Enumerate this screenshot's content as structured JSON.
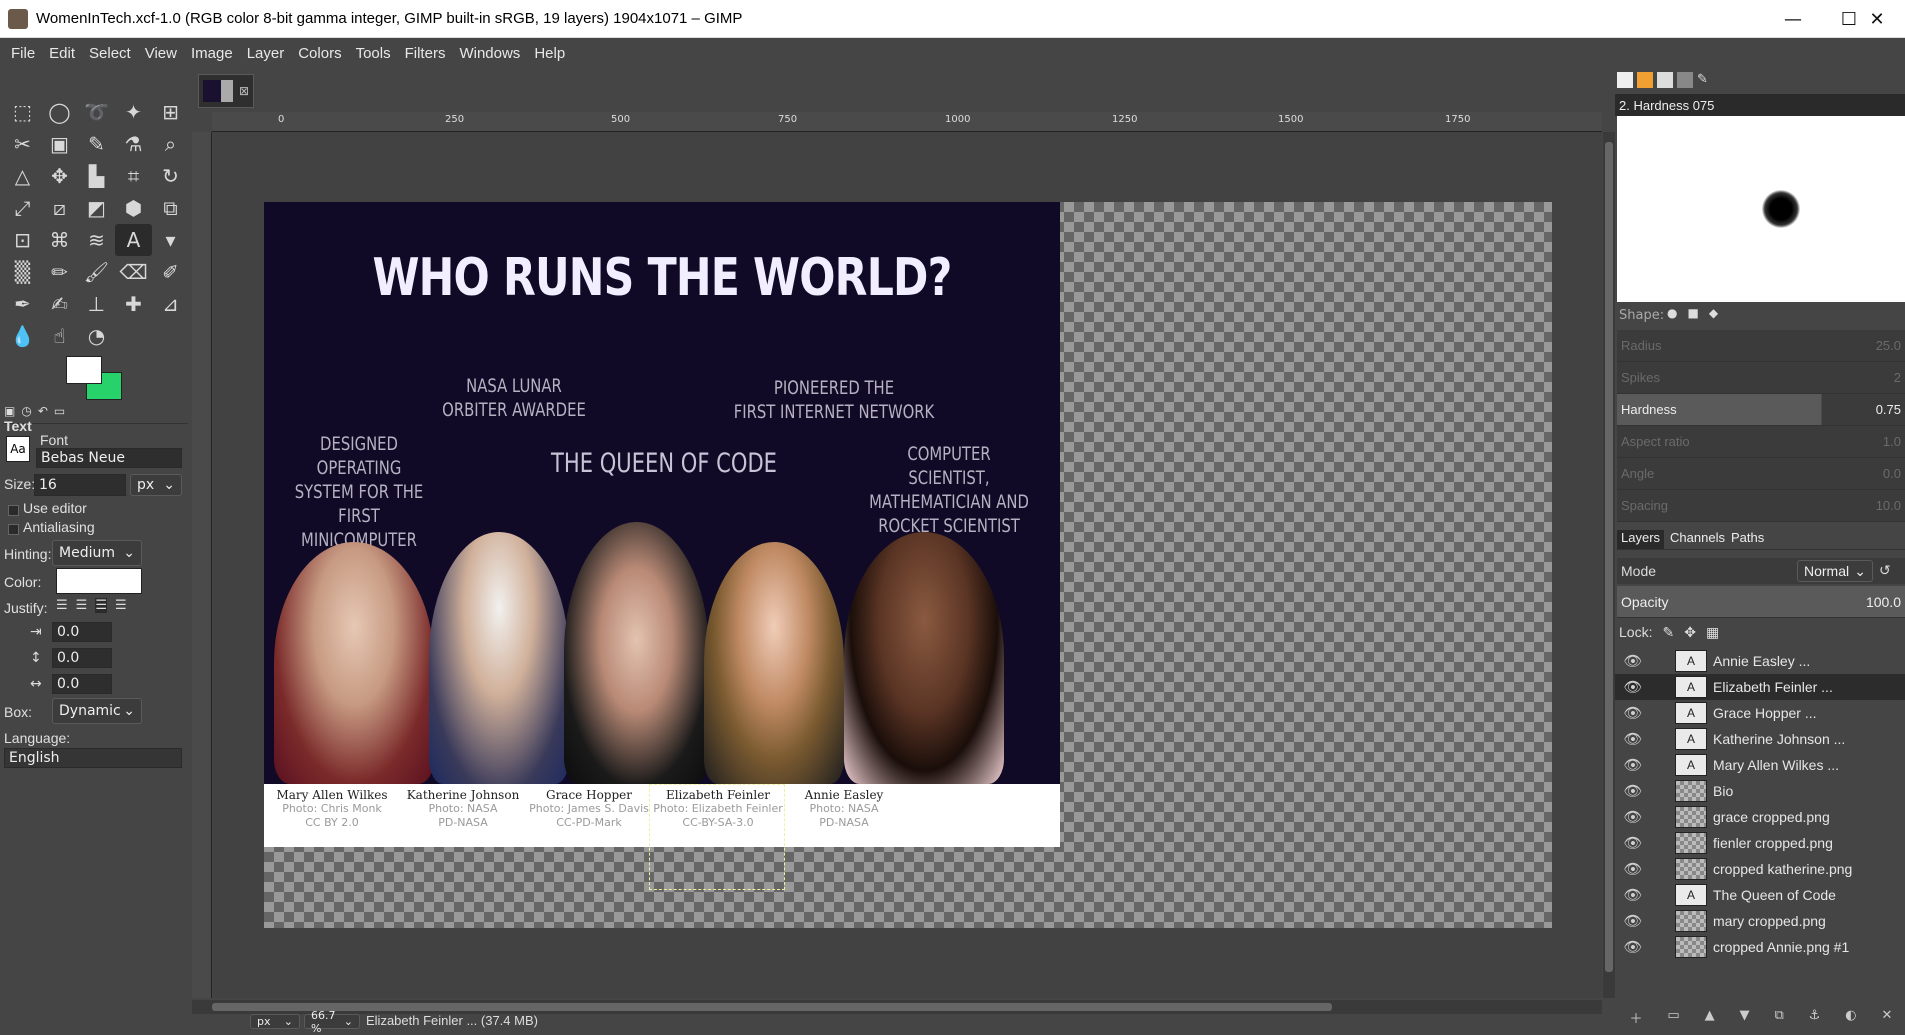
{
  "window": {
    "title": "WomenInTech.xcf-1.0 (RGB color 8-bit gamma integer, GIMP built-in sRGB, 19 layers) 1904x1071 – GIMP",
    "minimize": "—",
    "maximize": "☐",
    "close": "✕"
  },
  "menu": [
    "File",
    "Edit",
    "Select",
    "View",
    "Image",
    "Layer",
    "Colors",
    "Tools",
    "Filters",
    "Windows",
    "Help"
  ],
  "tool_options": {
    "section_title": "Text",
    "font_label": "Font",
    "font_value": "Bebas Neue",
    "size_label": "Size:",
    "size_value": "16",
    "size_unit": "px",
    "use_editor": "Use editor",
    "antialiasing": "Antialiasing",
    "hinting_label": "Hinting:",
    "hinting_value": "Medium",
    "color_label": "Color:",
    "justify_label": "Justify:",
    "indent": "0.0",
    "line_spacing": "0.0",
    "letter_spacing": "0.0",
    "box_label": "Box:",
    "box_value": "Dynamic",
    "language_label": "Language:",
    "language_value": "English"
  },
  "ruler": [
    "0",
    "250",
    "500",
    "750",
    "1000",
    "1250",
    "1500",
    "1750"
  ],
  "poster": {
    "headline": "WHO RUNS THE WORLD?",
    "t1": "NASA LUNAR\nORBITER AWARDEE",
    "t2": "PIONEERED THE\nFIRST INTERNET NETWORK",
    "t3": "DESIGNED OPERATING\nSYSTEM FOR THE\nFIRST MINICOMPUTER",
    "t4": "THE QUEEN OF CODE",
    "t5": "COMPUTER SCIENTIST,\nMATHEMATICIAN AND\nROCKET SCIENTIST",
    "captions": [
      {
        "name": "Mary Allen Wilkes",
        "credit": "Photo: Chris Monk",
        "license": "CC BY 2.0"
      },
      {
        "name": "Katherine Johnson",
        "credit": "Photo: NASA",
        "license": "PD-NASA"
      },
      {
        "name": "Grace Hopper",
        "credit": "Photo: James S. Davis",
        "license": "CC-PD-Mark"
      },
      {
        "name": "Elizabeth Feinler",
        "credit": "Photo: Elizabeth Feinler",
        "license": "CC-BY-SA-3.0"
      },
      {
        "name": "Annie Easley",
        "credit": "Photo: NASA",
        "license": "PD-NASA"
      }
    ]
  },
  "status": {
    "unit": "px",
    "zoom": "66.7 %",
    "message": "Elizabeth Feinler ... (37.4 MB)"
  },
  "brushes": {
    "selected": "2. Hardness 075",
    "shape_label": "Shape:",
    "sliders": [
      {
        "label": "Radius",
        "value": "25.0"
      },
      {
        "label": "Spikes",
        "value": "2"
      },
      {
        "label": "Hardness",
        "value": "0.75"
      },
      {
        "label": "Aspect ratio",
        "value": "1.0"
      },
      {
        "label": "Angle",
        "value": "0.0"
      },
      {
        "label": "Spacing",
        "value": "10.0"
      }
    ]
  },
  "layers_panel": {
    "tabs": [
      "Layers",
      "Channels",
      "Paths"
    ],
    "mode_label": "Mode",
    "mode_value": "Normal",
    "opacity_label": "Opacity",
    "opacity_value": "100.0",
    "lock_label": "Lock:",
    "layers": [
      {
        "name": "Annie Easley ...",
        "kind": "text"
      },
      {
        "name": "Elizabeth Feinler ...",
        "kind": "text"
      },
      {
        "name": "Grace Hopper ...",
        "kind": "text"
      },
      {
        "name": "Katherine Johnson ...",
        "kind": "text"
      },
      {
        "name": "Mary Allen Wilkes ...",
        "kind": "text"
      },
      {
        "name": "Bio",
        "kind": "image"
      },
      {
        "name": "grace cropped.png",
        "kind": "image"
      },
      {
        "name": "fienler cropped.png",
        "kind": "image"
      },
      {
        "name": "cropped katherine.png",
        "kind": "image"
      },
      {
        "name": "The Queen of Code",
        "kind": "text"
      },
      {
        "name": "mary cropped.png",
        "kind": "image"
      },
      {
        "name": "cropped Annie.png #1",
        "kind": "image"
      }
    ],
    "selected_layer": "Elizabeth Feinler ..."
  },
  "colors": {
    "foreground": "#ffffff",
    "background": "#27d26a",
    "poster_bg": "#110a26"
  }
}
